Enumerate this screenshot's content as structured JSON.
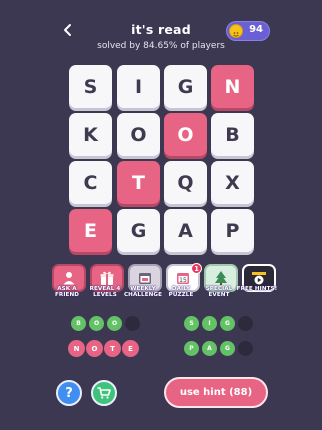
{
  "header": {
    "title": "it's read",
    "subtitle": "solved by 84.65% of players",
    "coins": "94"
  },
  "grid": [
    {
      "letter": "S",
      "highlight": false
    },
    {
      "letter": "I",
      "highlight": false
    },
    {
      "letter": "G",
      "highlight": false
    },
    {
      "letter": "N",
      "highlight": true
    },
    {
      "letter": "K",
      "highlight": false
    },
    {
      "letter": "O",
      "highlight": false
    },
    {
      "letter": "O",
      "highlight": true
    },
    {
      "letter": "B",
      "highlight": false
    },
    {
      "letter": "C",
      "highlight": false
    },
    {
      "letter": "T",
      "highlight": true
    },
    {
      "letter": "Q",
      "highlight": false
    },
    {
      "letter": "X",
      "highlight": false
    },
    {
      "letter": "E",
      "highlight": true
    },
    {
      "letter": "G",
      "highlight": false
    },
    {
      "letter": "A",
      "highlight": false
    },
    {
      "letter": "P",
      "highlight": false
    }
  ],
  "tools": [
    {
      "label": "ASK A FRIEND",
      "icon": "person-icon"
    },
    {
      "label": "REVEAL 4 LEVELS",
      "icon": "gift-icon"
    },
    {
      "label": "WEEKLY CHALLENGE",
      "icon": "calendar-icon"
    },
    {
      "label": "DAILY PUZZLE",
      "icon": "daily-calendar-icon",
      "badge": "1"
    },
    {
      "label": "SPECIAL EVENT",
      "icon": "tree-icon"
    },
    {
      "label": "FREE HINTS!",
      "icon": "video-icon"
    }
  ],
  "words": {
    "w1": [
      "B",
      "O",
      "O"
    ],
    "w2": [
      "S",
      "I",
      "G"
    ],
    "w3": [
      "N",
      "O",
      "T",
      "E"
    ],
    "w4": [
      "P",
      "A",
      "G"
    ]
  },
  "buttons": {
    "help": "?",
    "hint": "use hint (88)"
  },
  "colors": {
    "background": "#3d3852",
    "pink": "#e86484",
    "green": "#63c265",
    "tile": "#f7f7f9"
  }
}
